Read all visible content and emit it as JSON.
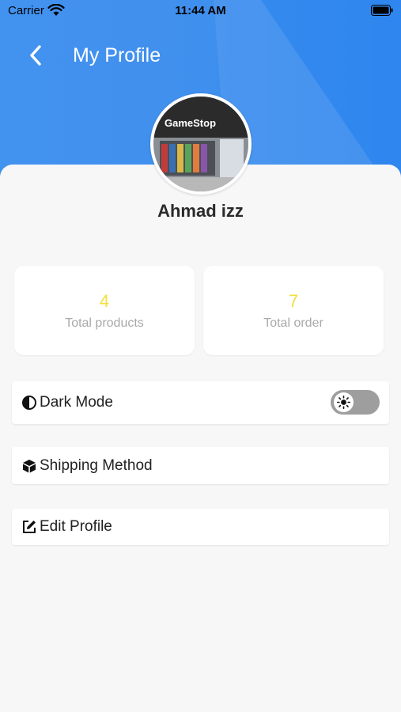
{
  "status_bar": {
    "carrier": "Carrier",
    "time": "11:44 AM"
  },
  "header": {
    "title": "My Profile",
    "back_icon": "chevron-left-icon",
    "background_color": "#3a8cee"
  },
  "profile": {
    "name": "Ahmad izz",
    "avatar_sign_text": "GameStop"
  },
  "stats": [
    {
      "value": "4",
      "label": "Total products"
    },
    {
      "value": "7",
      "label": "Total order"
    }
  ],
  "stat_value_color": "#f2e03a",
  "menu": {
    "dark_mode": {
      "label": "Dark Mode",
      "icon": "contrast-icon",
      "enabled": false
    },
    "shipping": {
      "label": "Shipping Method",
      "icon": "box-icon"
    },
    "edit_profile": {
      "label": "Edit Profile",
      "icon": "edit-icon"
    }
  }
}
